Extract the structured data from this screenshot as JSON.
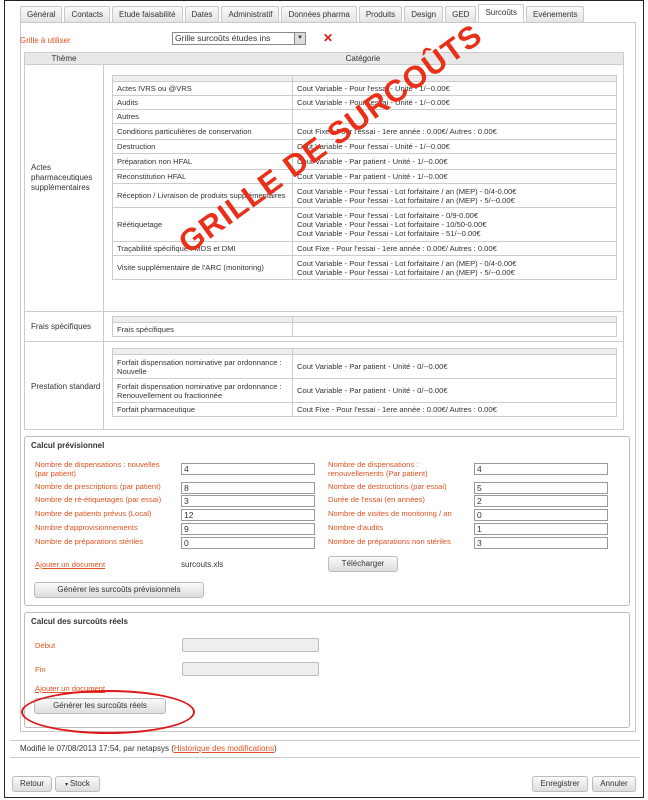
{
  "tabs": [
    "Général",
    "Contacts",
    "Etude faisabilité",
    "Dates",
    "Administratif",
    "Données pharma",
    "Produits",
    "Design",
    "GED",
    "Surcoûts",
    "Evénements"
  ],
  "active_tab": "Surcoûts",
  "grille": {
    "label": "Grille à utiliser",
    "value": "Grille surcoûts études ins"
  },
  "table_header": {
    "theme": "Thème",
    "categorie": "Catégorie"
  },
  "themes": [
    {
      "name": "Actes pharmaceutiques supplémentaires",
      "rows": [
        [
          "Actes IVRS ou @VRS",
          "Cout Variable - Pour l'essai - Unité - 1/--0.00€"
        ],
        [
          "Audits",
          "Cout Variable - Pour l'essai - Unité - 1/--0.00€"
        ],
        [
          "Autres",
          ""
        ],
        [
          "Conditions particulières de conservation",
          "Cout Fixe - Pour l'essai - 1ere année : 0.00€/ Autres : 0.00€"
        ],
        [
          "Destruction",
          "Cout Variable - Pour l'essai - Unité - 1/--0.00€"
        ],
        [
          "Préparation non HFAL",
          "Cout Variable - Par patient - Unité - 1/--0.00€"
        ],
        [
          "Reconstitution HFAL",
          "Cout Variable - Par patient - Unité - 1/--0.00€"
        ],
        [
          "Réception / Livraison de produits supplémentaires",
          "Cout Variable - Pour l'essai - Lot forfaitaire / an (MEP) - 0/4-0.00€\nCout Variable - Pour l'essai - Lot forfaitaire / an (MEP) - 5/--0.00€"
        ],
        [
          "Réétiquetage",
          "Cout Variable - Pour l'essai - Lot forfaitaire - 0/9-0.00€\nCout Variable - Pour l'essai - Lot forfaitaire - 10/50-0.00€\nCout Variable - Pour l'essai - Lot forfaitaire - 51/--0.00€"
        ],
        [
          "Traçabilité spécifique : MDS et DMI",
          "Cout Fixe - Pour l'essai - 1ere année : 0.00€/ Autres : 0.00€"
        ],
        [
          "Visite supplémentaire de l'ARC (monitoring)",
          "Cout Variable - Pour l'essai - Lot forfaitaire / an (MEP) - 0/4-0.00€\nCout Variable - Pour l'essai - Lot forfaitaire / an (MEP) - 5/--0.00€"
        ]
      ]
    },
    {
      "name": "Frais spécifiques",
      "rows": [
        [
          "Frais spécifiques",
          ""
        ]
      ]
    },
    {
      "name": "Prestation standard",
      "rows": [
        [
          "Forfait dispensation nominative par ordonnance : Nouvelle",
          "Cout Variable - Par patient - Unité - 0/--0.00€"
        ],
        [
          "Forfait dispensation nominative par ordonnance : Renouvellement ou fractionnée",
          "Cout Variable - Par patient - Unité - 0/--0.00€"
        ],
        [
          "Forfait pharmaceutique",
          "Cout Fixe - Pour l'essai - 1ere année : 0.00€/ Autres : 0.00€"
        ]
      ]
    }
  ],
  "watermark": "GRILLE DE SURCOÛTS",
  "calcul_prev": {
    "title": "Calcul prévisionnel",
    "left": [
      {
        "label": "Nombre de dispensations : nouvelles (par patient)",
        "value": "4"
      },
      {
        "label": "Nombre de prescriptions (par patient)",
        "value": "8"
      },
      {
        "label": "Nombre de ré-étiquetages (par essai)",
        "value": "3"
      },
      {
        "label": "Nombre de patients prévus (Local)",
        "value": "12"
      },
      {
        "label": "Nombre d'approvisionnements",
        "value": "9"
      },
      {
        "label": "Nombre de préparations stériles",
        "value": "0"
      }
    ],
    "right": [
      {
        "label": "Nombre de dispensations : renouvellements (Par patient)",
        "value": "4"
      },
      {
        "label": "Nombre de destructions (par essai)",
        "value": "5"
      },
      {
        "label": "Durée de l'essai (en années)",
        "value": "2"
      },
      {
        "label": "Nombre de visites de monitoring / an",
        "value": "0"
      },
      {
        "label": "Nombre d'audits",
        "value": "1"
      },
      {
        "label": "Nombre de préparations non stériles",
        "value": "3"
      }
    ],
    "add_doc": "Ajouter un document",
    "file": "surcouts.xls",
    "download": "Télécharger",
    "generate": "Générer les surcoûts prévisionnels"
  },
  "calcul_reel": {
    "title": "Calcul des surcoûts réels",
    "debut": "Début",
    "fin": "Fin",
    "add_doc": "Ajouter un document",
    "generate": "Générer les surcoûts réels"
  },
  "footer": {
    "modified": "Modifié le 07/08/2013 17:54, par netapsys (",
    "history": "Historique des modifications",
    "close_paren": ")"
  },
  "buttons": {
    "retour": "Retour",
    "stock": "Stock",
    "enregistrer": "Enregistrer",
    "annuler": "Annuler"
  },
  "colors": {
    "label": "#e0521f",
    "watermark": "#e8301a",
    "ellipse": "#e0161a"
  }
}
